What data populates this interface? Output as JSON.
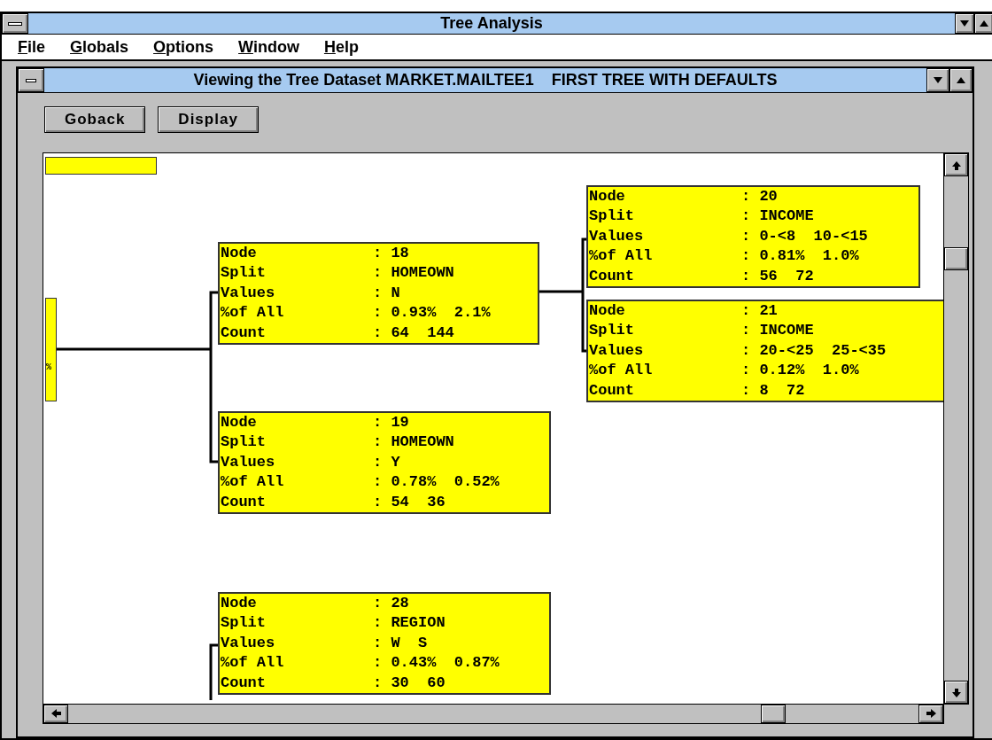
{
  "window": {
    "title": "Tree Analysis"
  },
  "menu": [
    {
      "label": "File"
    },
    {
      "label": "Globals"
    },
    {
      "label": "Options"
    },
    {
      "label": "Window"
    },
    {
      "label": "Help"
    }
  ],
  "child_window": {
    "title": "Viewing the Tree Dataset MARKET.MAILTEE1    FIRST TREE WITH DEFAULTS"
  },
  "buttons": [
    "Goback",
    "Display"
  ],
  "tree": {
    "fragment": "%",
    "nodes": [
      {
        "rows": [
          {
            "label": "Node",
            "value": ": 18"
          },
          {
            "label": "Split",
            "value": ": HOMEOWN"
          },
          {
            "label": "Values",
            "value": ": N"
          },
          {
            "label": "%of All",
            "value": ": 0.93%  2.1%"
          },
          {
            "label": "Count",
            "value": ": 64  144"
          }
        ]
      },
      {
        "rows": [
          {
            "label": "Node",
            "value": ": 19"
          },
          {
            "label": "Split",
            "value": ": HOMEOWN"
          },
          {
            "label": "Values",
            "value": ": Y"
          },
          {
            "label": "%of All",
            "value": ": 0.78%  0.52%"
          },
          {
            "label": "Count",
            "value": ": 54  36"
          }
        ]
      },
      {
        "rows": [
          {
            "label": "Node",
            "value": ": 20"
          },
          {
            "label": "Split",
            "value": ": INCOME"
          },
          {
            "label": "Values",
            "value": ": 0-<8  10-<15"
          },
          {
            "label": "%of All",
            "value": ": 0.81%  1.0%"
          },
          {
            "label": "Count",
            "value": ": 56  72"
          }
        ]
      },
      {
        "rows": [
          {
            "label": "Node",
            "value": ": 21"
          },
          {
            "label": "Split",
            "value": ": INCOME"
          },
          {
            "label": "Values",
            "value": ": 20-<25  25-<35"
          },
          {
            "label": "%of All",
            "value": ": 0.12%  1.0%"
          },
          {
            "label": "Count",
            "value": ": 8  72"
          }
        ]
      },
      {
        "rows": [
          {
            "label": "Node",
            "value": ": 28"
          },
          {
            "label": "Split",
            "value": ": REGION"
          },
          {
            "label": "Values",
            "value": ": W  S"
          },
          {
            "label": "%of All",
            "value": ": 0.43%  0.87%"
          },
          {
            "label": "Count",
            "value": ": 30  60"
          }
        ]
      }
    ]
  }
}
